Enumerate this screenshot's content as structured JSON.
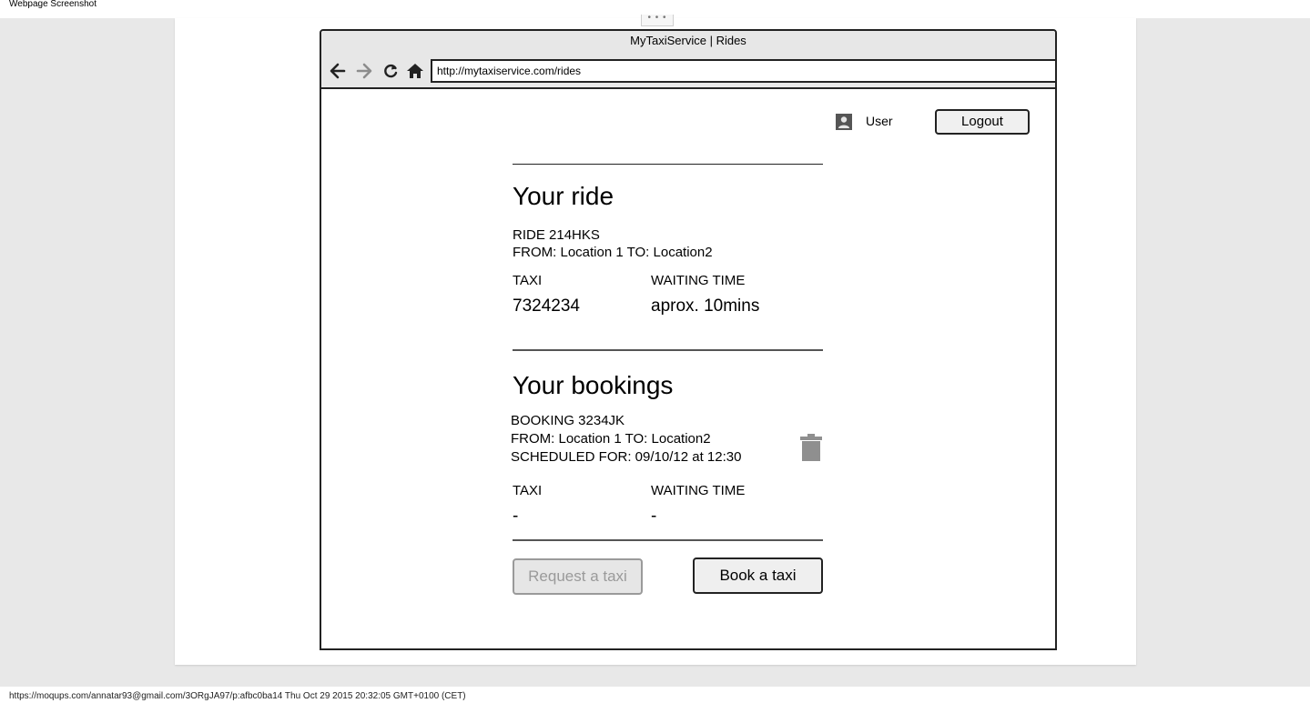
{
  "screenshot": {
    "header_text": "Webpage Screenshot",
    "handle_text": "• • •",
    "footer_text": "https://moqups.com/annatar93@gmail.com/3ORgJA97/p:afbc0ba14 Thu Oct 29 2015 20:32:05 GMT+0100 (CET)"
  },
  "browser": {
    "title": "MyTaxiService | Rides",
    "url": "http://mytaxiservice.com/rides",
    "nav_icons": [
      "back-arrow-icon",
      "forward-arrow-icon",
      "reload-icon",
      "home-icon"
    ]
  },
  "header": {
    "user_label": "User",
    "logout_label": "Logout"
  },
  "ride": {
    "heading": "Your ride",
    "id_line": "RIDE 214HKS",
    "route_line": "FROM: Location 1 TO: Location2",
    "taxi_label": "TAXI",
    "taxi_value": "7324234",
    "waiting_label": "WAITING TIME",
    "waiting_value": "aprox. 10mins"
  },
  "bookings": {
    "heading": "Your bookings",
    "items": [
      {
        "id_line": "BOOKING 3234JK",
        "route_line": "FROM: Location 1 TO: Location2",
        "scheduled_line": "SCHEDULED FOR: 09/10/12 at 12:30",
        "taxi_label": "TAXI",
        "taxi_value": "-",
        "waiting_label": "WAITING TIME",
        "waiting_value": "-"
      }
    ]
  },
  "actions": {
    "request_label": "Request a taxi",
    "request_enabled": false,
    "book_label": "Book a taxi"
  },
  "colors": {
    "canvas_bg": "#e8e8e8",
    "chrome_bg": "#e7e7e7",
    "disabled_text": "#9a9a9a",
    "trash_icon": "#8f8f8f"
  }
}
